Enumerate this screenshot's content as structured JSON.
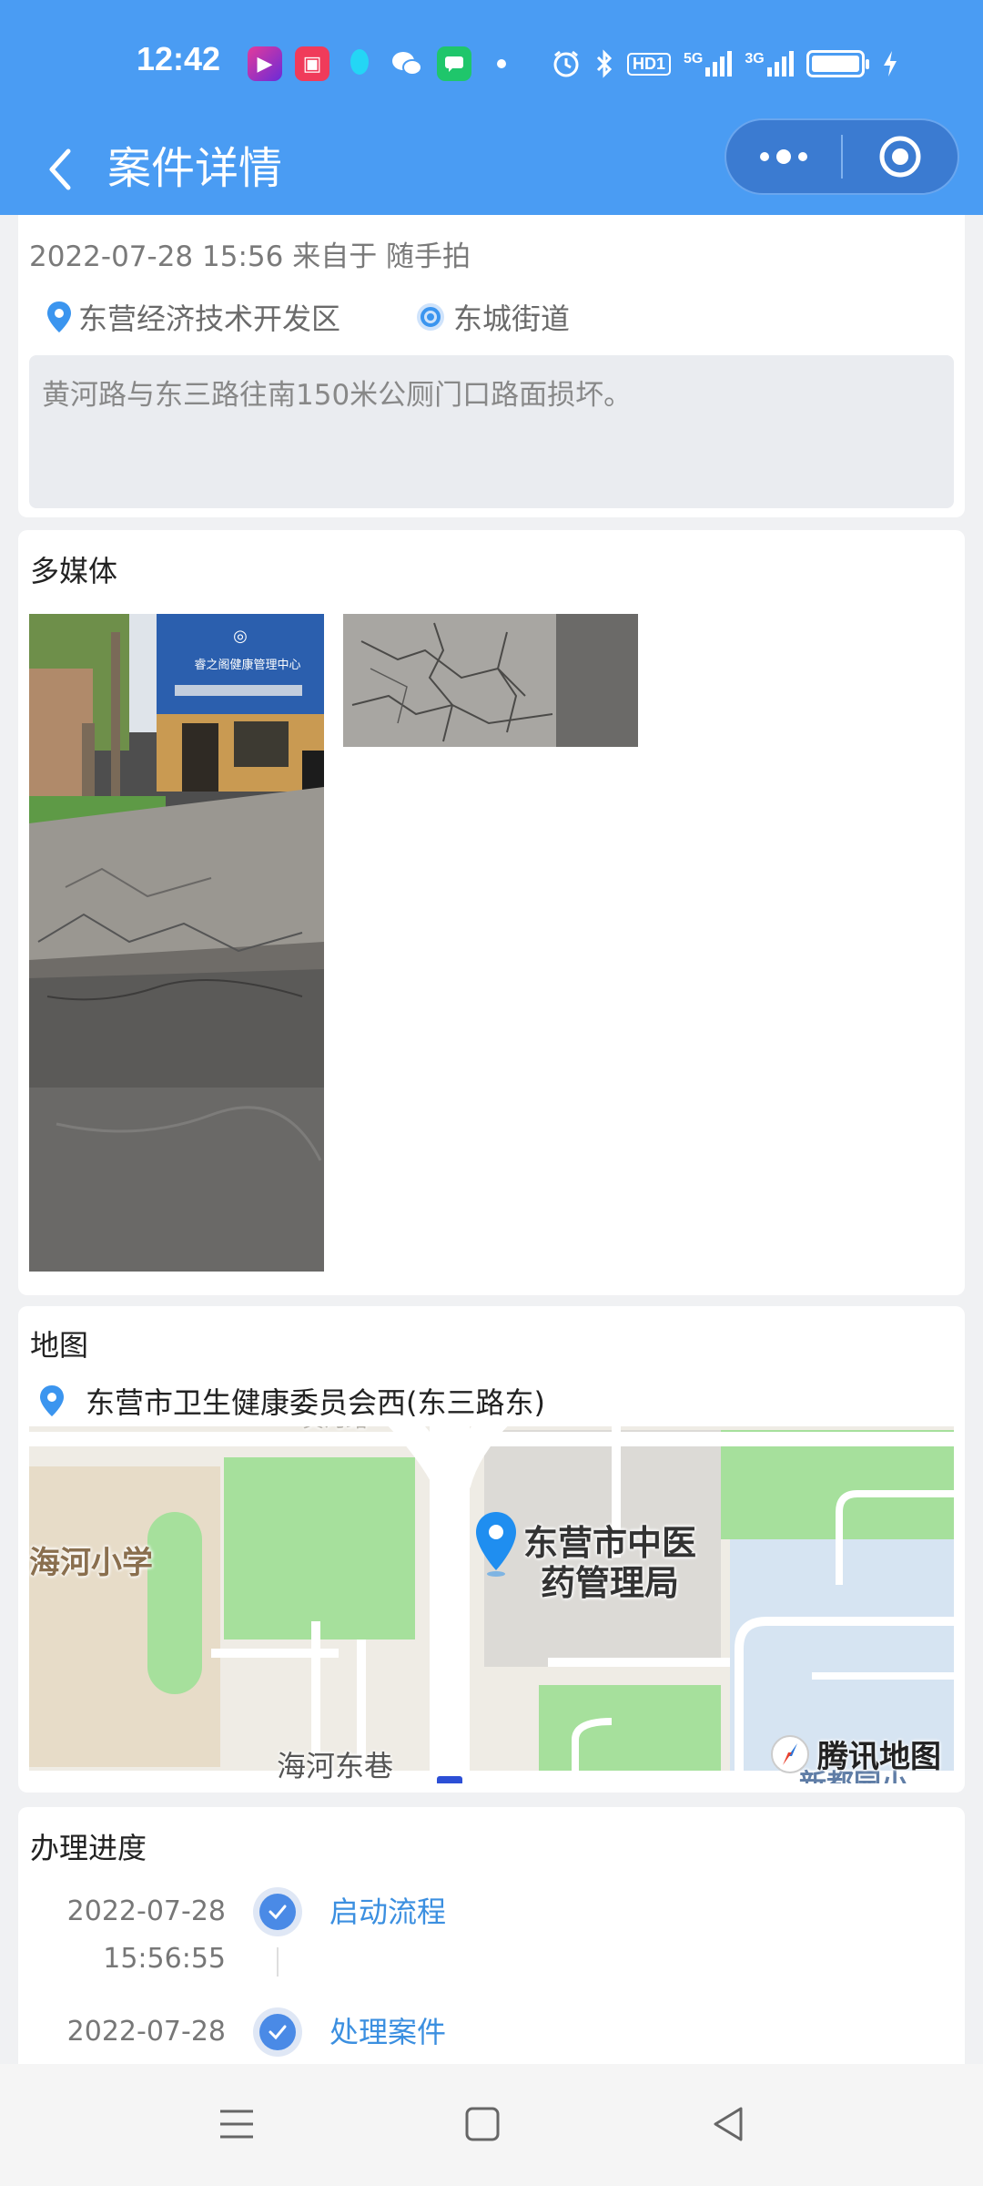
{
  "status_bar": {
    "time": "12:42",
    "network": [
      "HD1",
      "5G",
      "3G"
    ],
    "icons": [
      "video-app-icon",
      "bilibili-icon",
      "qq-icon",
      "wechat-icon",
      "message-icon",
      "dot-icon",
      "alarm-icon",
      "bluetooth-icon",
      "battery-icon",
      "charging-icon"
    ]
  },
  "nav": {
    "title": "案件详情"
  },
  "case": {
    "meta": "2022-07-28 15:56 来自于 随手拍",
    "district": "东营经济技术开发区",
    "street": "东城街道",
    "description": "黄河路与东三路往南150米公厕门口路面损坏。"
  },
  "media": {
    "title": "多媒体",
    "photos": [
      "street-photo",
      "cracked-road-photo"
    ],
    "sign_text": "睿之阁健康管理中心"
  },
  "map": {
    "title": "地图",
    "address": "东营市卫生健康委员会西(东三路东)",
    "labels": {
      "poi": "东营市中医\n药管理局",
      "school": "海河小学",
      "lane": "海河东巷",
      "road_top": "黄河路",
      "bottom_right": "新都园小"
    },
    "brand": "腾讯地图"
  },
  "progress": {
    "title": "办理进度",
    "steps": [
      {
        "date": "2022-07-28",
        "time": "15:56:55",
        "name": "启动流程"
      },
      {
        "date": "2022-07-28",
        "time": "",
        "name": "处理案件"
      }
    ]
  },
  "colors": {
    "primary": "#4a9cf3",
    "link": "#3b8fe0",
    "background": "#f0f1f3"
  }
}
